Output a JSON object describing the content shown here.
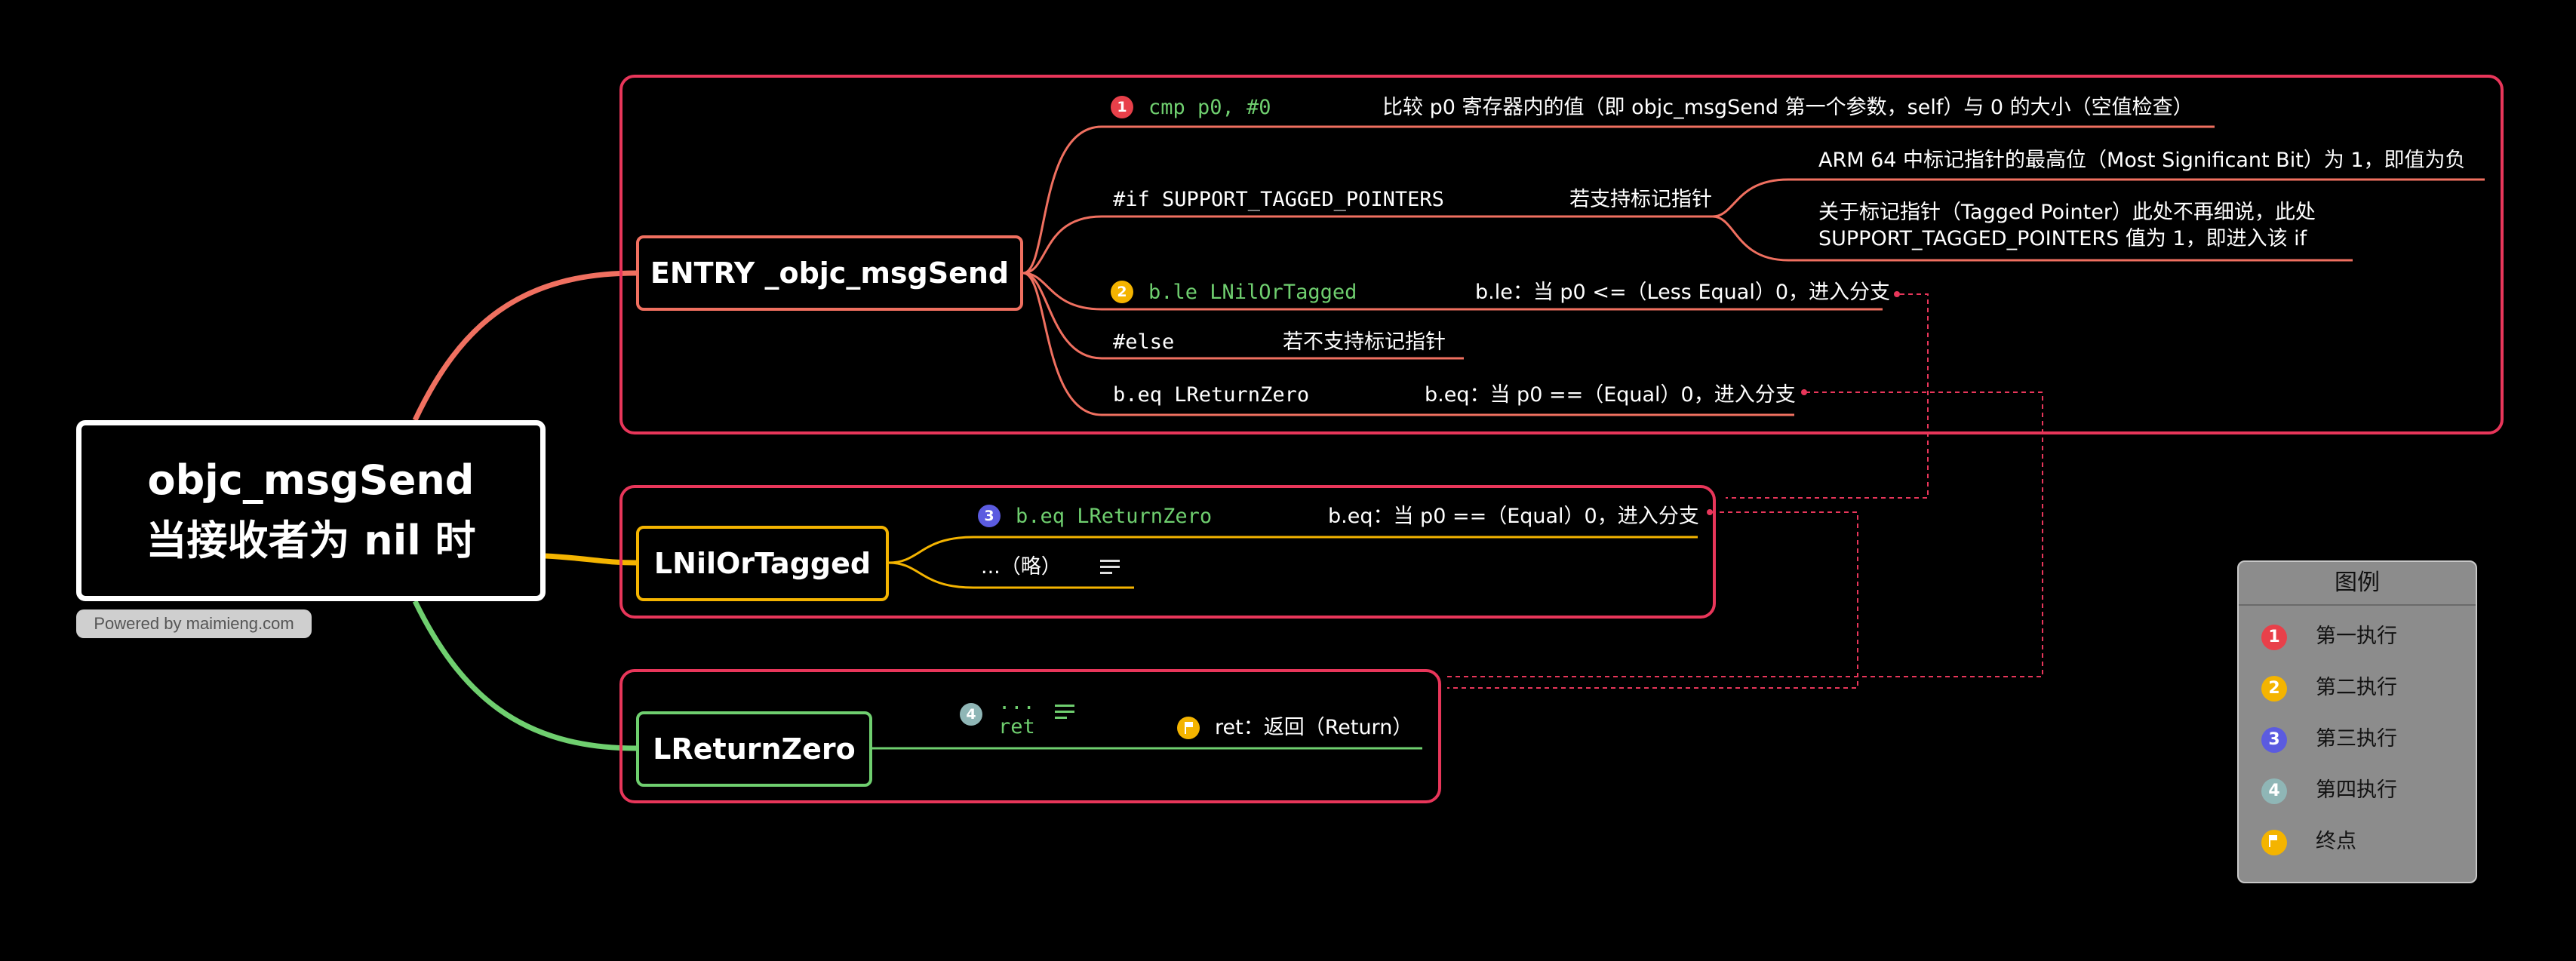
{
  "root": {
    "line1": "objc_msgSend",
    "line2": "当接收者为 nil 时"
  },
  "powered_by": "Powered by maimieng.com",
  "entry": {
    "title": "ENTRY _objc_msgSend",
    "cmp_code": "cmp p0, #0",
    "cmp_desc": "比较 p0 寄存器内的值（即 objc_msgSend 第一个参数，self）与 0 的大小（空值检查）",
    "if_code": "#if SUPPORT_TAGGED_POINTERS",
    "if_desc": "若支持标记指针",
    "arm_note": "ARM 64 中标记指针的最高位（Most Significant Bit）为 1，即值为负",
    "tagged_note_line1": "关于标记指针（Tagged Pointer）此处不再细说，此处",
    "tagged_note_line2": "SUPPORT_TAGGED_POINTERS 值为 1，即进入该 if",
    "ble_code": "b.le LNilOrTagged",
    "ble_desc": "b.le：当 p0 <=（Less Equal）0，进入分支",
    "else_code": "#else",
    "else_desc": "若不支持标记指针",
    "beq_code": "b.eq LReturnZero",
    "beq_desc": "b.eq：当 p0 ==（Equal）0，进入分支"
  },
  "nil_or_tagged": {
    "title": "LNilOrTagged",
    "beq_code": "b.eq LReturnZero",
    "beq_desc": "b.eq：当 p0 ==（Equal）0，进入分支",
    "omitted": "...（略）"
  },
  "return_zero": {
    "title": "LReturnZero",
    "code_line1": "...",
    "code_line2": "ret",
    "ret_desc": "ret：返回（Return）"
  },
  "steps": {
    "s1": "1",
    "s2": "2",
    "s3": "3",
    "s4": "4"
  },
  "legend": {
    "title": "图例",
    "items": [
      {
        "num": "1",
        "label": "第一执行",
        "color": "#e8404a"
      },
      {
        "num": "2",
        "label": "第二执行",
        "color": "#f4b400"
      },
      {
        "num": "3",
        "label": "第三执行",
        "color": "#5b5be0"
      },
      {
        "num": "4",
        "label": "第四执行",
        "color": "#8fb6b6"
      },
      {
        "num": "",
        "label": "终点",
        "color": "#f4b400",
        "icon": "flag-icon"
      }
    ]
  },
  "colors": {
    "box_border": "#e8365a",
    "entry_branch": "#f07060",
    "nil_branch": "#f4b400",
    "zero_branch": "#6fcf6f",
    "code_green": "#6fcf6f"
  }
}
